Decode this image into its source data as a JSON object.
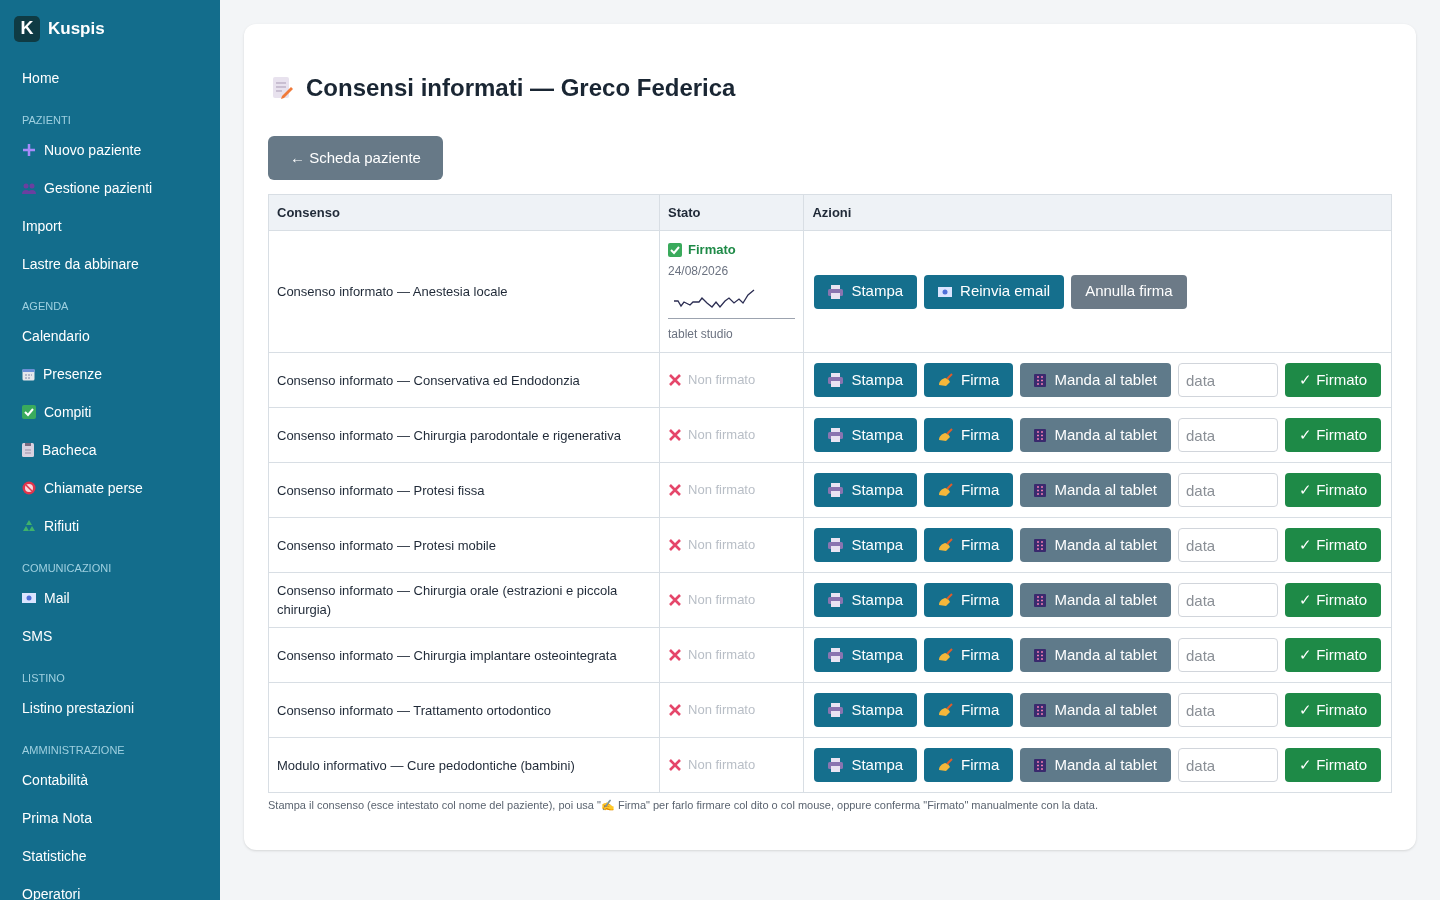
{
  "sidebar": {
    "brand_letter": "K",
    "brand": "Kuspis",
    "sections": [
      {
        "items": [
          {
            "label": "Home"
          }
        ]
      },
      {
        "heading": "PAZIENTI",
        "items": [
          {
            "label": "Nuovo paziente",
            "icon": true
          },
          {
            "label": "Gestione pazienti",
            "icon": true
          },
          {
            "label": "Import"
          },
          {
            "label": "Lastre da abbinare"
          }
        ]
      },
      {
        "heading": "AGENDA",
        "items": [
          {
            "label": "Calendario"
          },
          {
            "label": "Presenze",
            "icon": true
          },
          {
            "label": "Compiti",
            "icon": true
          },
          {
            "label": "Bacheca",
            "icon": true
          },
          {
            "label": "Chiamate perse",
            "icon": true
          },
          {
            "label": "Rifiuti",
            "icon": true
          }
        ]
      },
      {
        "heading": "COMUNICAZIONI",
        "items": [
          {
            "label": "Mail",
            "icon": true
          },
          {
            "label": "SMS"
          }
        ]
      },
      {
        "heading": "LISTINO",
        "items": [
          {
            "label": "Listino prestazioni"
          }
        ]
      },
      {
        "heading": "AMMINISTRAZIONE",
        "items": [
          {
            "label": "Contabilità"
          },
          {
            "label": "Prima Nota"
          },
          {
            "label": "Statistiche"
          },
          {
            "label": "Operatori"
          }
        ]
      }
    ]
  },
  "title": "Consensi informati — Greco Federica",
  "back_button": "← Scheda paziente",
  "table": {
    "columns": [
      "Consenso",
      "Stato",
      "Azioni"
    ],
    "rows": [
      {
        "consent": "Consenso informato — Anestesia locale",
        "signed": true,
        "status": "Firmato",
        "date": "24/08/2026",
        "device": "tablet studio",
        "actions": [
          {
            "kind": "print",
            "label": "Stampa"
          },
          {
            "kind": "email",
            "label": "Reinvia email"
          },
          {
            "kind": "cancel",
            "label": "Annulla firma"
          }
        ]
      },
      {
        "consent": "Consenso informato — Conservativa ed Endodonzia",
        "signed": false,
        "status": "Non firmato",
        "date_placeholder": "data",
        "actions": [
          {
            "kind": "print",
            "label": "Stampa"
          },
          {
            "kind": "sign",
            "label": "Firma"
          },
          {
            "kind": "tablet",
            "label": "Manda al tablet"
          },
          {
            "kind": "confirm",
            "label": "✓ Firmato"
          }
        ]
      },
      {
        "consent": "Consenso informato — Chirurgia parodontale e rigenerativa",
        "signed": false,
        "status": "Non firmato",
        "date_placeholder": "data",
        "actions": [
          {
            "kind": "print",
            "label": "Stampa"
          },
          {
            "kind": "sign",
            "label": "Firma"
          },
          {
            "kind": "tablet",
            "label": "Manda al tablet"
          },
          {
            "kind": "confirm",
            "label": "✓ Firmato"
          }
        ]
      },
      {
        "consent": "Consenso informato — Protesi fissa",
        "signed": false,
        "status": "Non firmato",
        "date_placeholder": "data",
        "actions": [
          {
            "kind": "print",
            "label": "Stampa"
          },
          {
            "kind": "sign",
            "label": "Firma"
          },
          {
            "kind": "tablet",
            "label": "Manda al tablet"
          },
          {
            "kind": "confirm",
            "label": "✓ Firmato"
          }
        ]
      },
      {
        "consent": "Consenso informato — Protesi mobile",
        "signed": false,
        "status": "Non firmato",
        "date_placeholder": "data",
        "actions": [
          {
            "kind": "print",
            "label": "Stampa"
          },
          {
            "kind": "sign",
            "label": "Firma"
          },
          {
            "kind": "tablet",
            "label": "Manda al tablet"
          },
          {
            "kind": "confirm",
            "label": "✓ Firmato"
          }
        ]
      },
      {
        "consent": "Consenso informato — Chirurgia orale (estrazioni e piccola chirurgia)",
        "signed": false,
        "status": "Non firmato",
        "date_placeholder": "data",
        "actions": [
          {
            "kind": "print",
            "label": "Stampa"
          },
          {
            "kind": "sign",
            "label": "Firma"
          },
          {
            "kind": "tablet",
            "label": "Manda al tablet"
          },
          {
            "kind": "confirm",
            "label": "✓ Firmato"
          }
        ]
      },
      {
        "consent": "Consenso informato — Chirurgia implantare osteointegrata",
        "signed": false,
        "status": "Non firmato",
        "date_placeholder": "data",
        "actions": [
          {
            "kind": "print",
            "label": "Stampa"
          },
          {
            "kind": "sign",
            "label": "Firma"
          },
          {
            "kind": "tablet",
            "label": "Manda al tablet"
          },
          {
            "kind": "confirm",
            "label": "✓ Firmato"
          }
        ]
      },
      {
        "consent": "Consenso informato — Trattamento ortodontico",
        "signed": false,
        "status": "Non firmato",
        "date_placeholder": "data",
        "actions": [
          {
            "kind": "print",
            "label": "Stampa"
          },
          {
            "kind": "sign",
            "label": "Firma"
          },
          {
            "kind": "tablet",
            "label": "Manda al tablet"
          },
          {
            "kind": "confirm",
            "label": "✓ Firmato"
          }
        ]
      },
      {
        "consent": "Modulo informativo — Cure pedodontiche (bambini)",
        "signed": false,
        "status": "Non firmato",
        "date_placeholder": "data",
        "actions": [
          {
            "kind": "print",
            "label": "Stampa"
          },
          {
            "kind": "sign",
            "label": "Firma"
          },
          {
            "kind": "tablet",
            "label": "Manda al tablet"
          },
          {
            "kind": "confirm",
            "label": "✓ Firmato"
          }
        ]
      }
    ]
  },
  "footnote": "Stampa il consenso (esce intestato col nome del paziente), poi usa \"✍ Firma\" per farlo firmare col dito o col mouse, oppure conferma \"Firmato\" manualmente con la data."
}
